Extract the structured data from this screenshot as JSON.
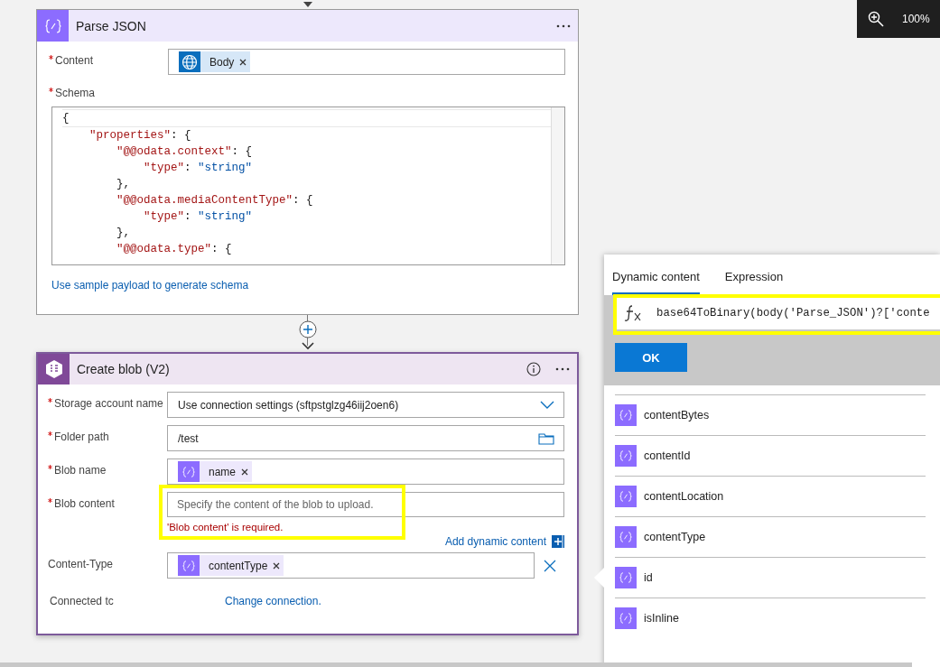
{
  "zoom": {
    "text": "100%"
  },
  "parse_json": {
    "title": "Parse JSON",
    "fields": [
      {
        "label": "Content",
        "required": true,
        "kind": "tokens",
        "tokens": [
          {
            "label": "Body",
            "kind": "globe"
          }
        ]
      }
    ],
    "schema": {
      "label": "Schema",
      "required": true,
      "lines": [
        [
          {
            "kind": "punct",
            "text": "{"
          }
        ],
        [
          {
            "kind": "key",
            "text": "    \"properties\""
          },
          {
            "kind": "punct",
            "text": ": {"
          }
        ],
        [
          {
            "kind": "key",
            "text": "        \"@@odata.context\""
          },
          {
            "kind": "punct",
            "text": ": {"
          }
        ],
        [
          {
            "kind": "key",
            "text": "            \"type\""
          },
          {
            "kind": "punct",
            "text": ": "
          },
          {
            "kind": "string",
            "text": "\"string\""
          }
        ],
        [
          {
            "kind": "punct",
            "text": "        },"
          }
        ],
        [
          {
            "kind": "key",
            "text": "        \"@@odata.mediaContentType\""
          },
          {
            "kind": "punct",
            "text": ": {"
          }
        ],
        [
          {
            "kind": "key",
            "text": "            \"type\""
          },
          {
            "kind": "punct",
            "text": ": "
          },
          {
            "kind": "string",
            "text": "\"string\""
          }
        ],
        [
          {
            "kind": "punct",
            "text": "        },"
          }
        ],
        [
          {
            "kind": "key",
            "text": "        \"@@odata.type\""
          },
          {
            "kind": "punct",
            "text": ": {"
          }
        ]
      ]
    },
    "link": "Use sample payload to generate schema"
  },
  "create_blob": {
    "title": "Create blob (V2)",
    "fields": [
      {
        "label": "Storage account name",
        "required": true,
        "kind": "dropdown",
        "value": "Use connection settings (sftpstglzg46iij2oen6)"
      },
      {
        "label": "Folder path",
        "required": true,
        "kind": "folder",
        "value": "/test"
      },
      {
        "label": "Blob name",
        "required": true,
        "kind": "tokens",
        "tokens": [
          {
            "label": "name",
            "kind": "braces"
          }
        ]
      },
      {
        "label": "Blob content",
        "required": true,
        "kind": "text",
        "placeholder": "Specify the content of the blob to upload.",
        "error": "'Blob content' is required.",
        "dynamic_link": "Add dynamic content"
      },
      {
        "label": "Content-Type",
        "kind": "tokens",
        "removable": true,
        "tokens": [
          {
            "label": "contentType",
            "kind": "braces"
          }
        ]
      }
    ],
    "connection": {
      "label": "Connected tc",
      "link": "Change connection."
    }
  },
  "panel": {
    "tabs": [
      {
        "label": "Dynamic content",
        "selected": true
      },
      {
        "label": "Expression",
        "selected": false
      }
    ],
    "expression": "base64ToBinary(body('Parse_JSON')?['conte",
    "ok": "OK",
    "items": [
      {
        "label": "contentBytes"
      },
      {
        "label": "contentId"
      },
      {
        "label": "contentLocation"
      },
      {
        "label": "contentType"
      },
      {
        "label": "id"
      },
      {
        "label": "isInline"
      }
    ]
  }
}
